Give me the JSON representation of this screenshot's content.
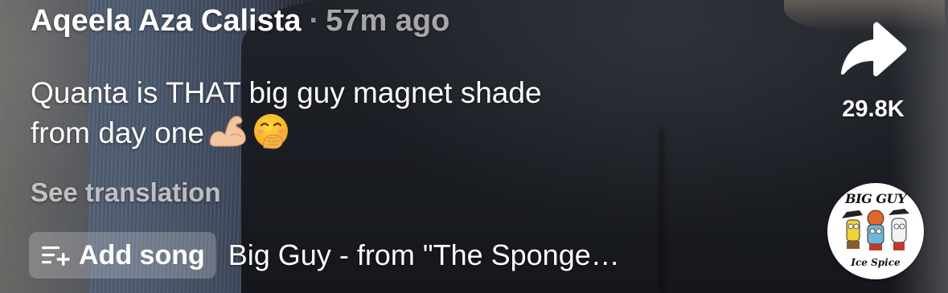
{
  "post": {
    "username": "Aqeela Aza Calista",
    "separator": "·",
    "time_ago": "57m ago",
    "caption_line1": "Quanta is THAT big guy magnet shade",
    "caption_line2": "from day one",
    "caption_emojis": [
      "flexed-biceps",
      "face-with-hand-over-mouth"
    ],
    "see_translation": "See translation"
  },
  "music": {
    "add_song_label": "Add song",
    "song_title": "Big Guy - from \"The Sponge…",
    "disc_top_text": "BIG GUY",
    "disc_bottom_text": "Ice Spice"
  },
  "actions": {
    "share_count": "29.8K",
    "share_icon": "share-arrow-icon"
  },
  "colors": {
    "text_primary": "#ffffff",
    "text_secondary": "#b5b5b5",
    "add_song_bg": "rgba(255,255,255,0.22)"
  }
}
